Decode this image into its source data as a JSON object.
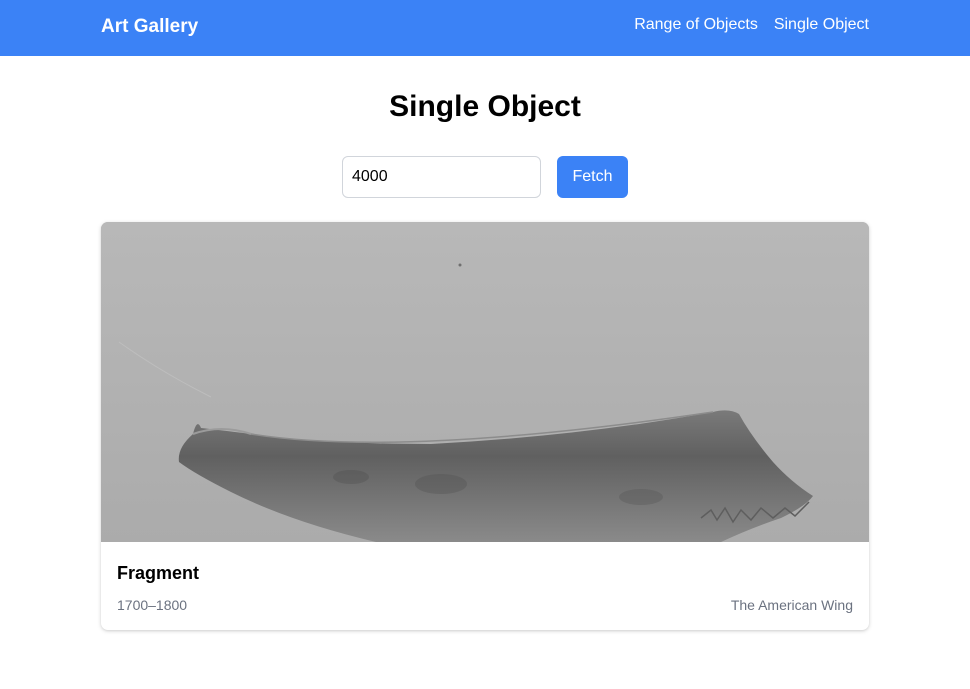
{
  "navbar": {
    "brand": "Art Gallery",
    "links": [
      {
        "label": "Range of Objects"
      },
      {
        "label": "Single Object"
      }
    ],
    "color": "#3b82f6"
  },
  "page": {
    "title": "Single Object"
  },
  "form": {
    "object_id_value": "4000",
    "fetch_label": "Fetch"
  },
  "object": {
    "title": "Fragment",
    "date": "1700–1800",
    "department": "The American Wing",
    "image_description_icon": "grayscale-photo-of-curved-fragment"
  }
}
